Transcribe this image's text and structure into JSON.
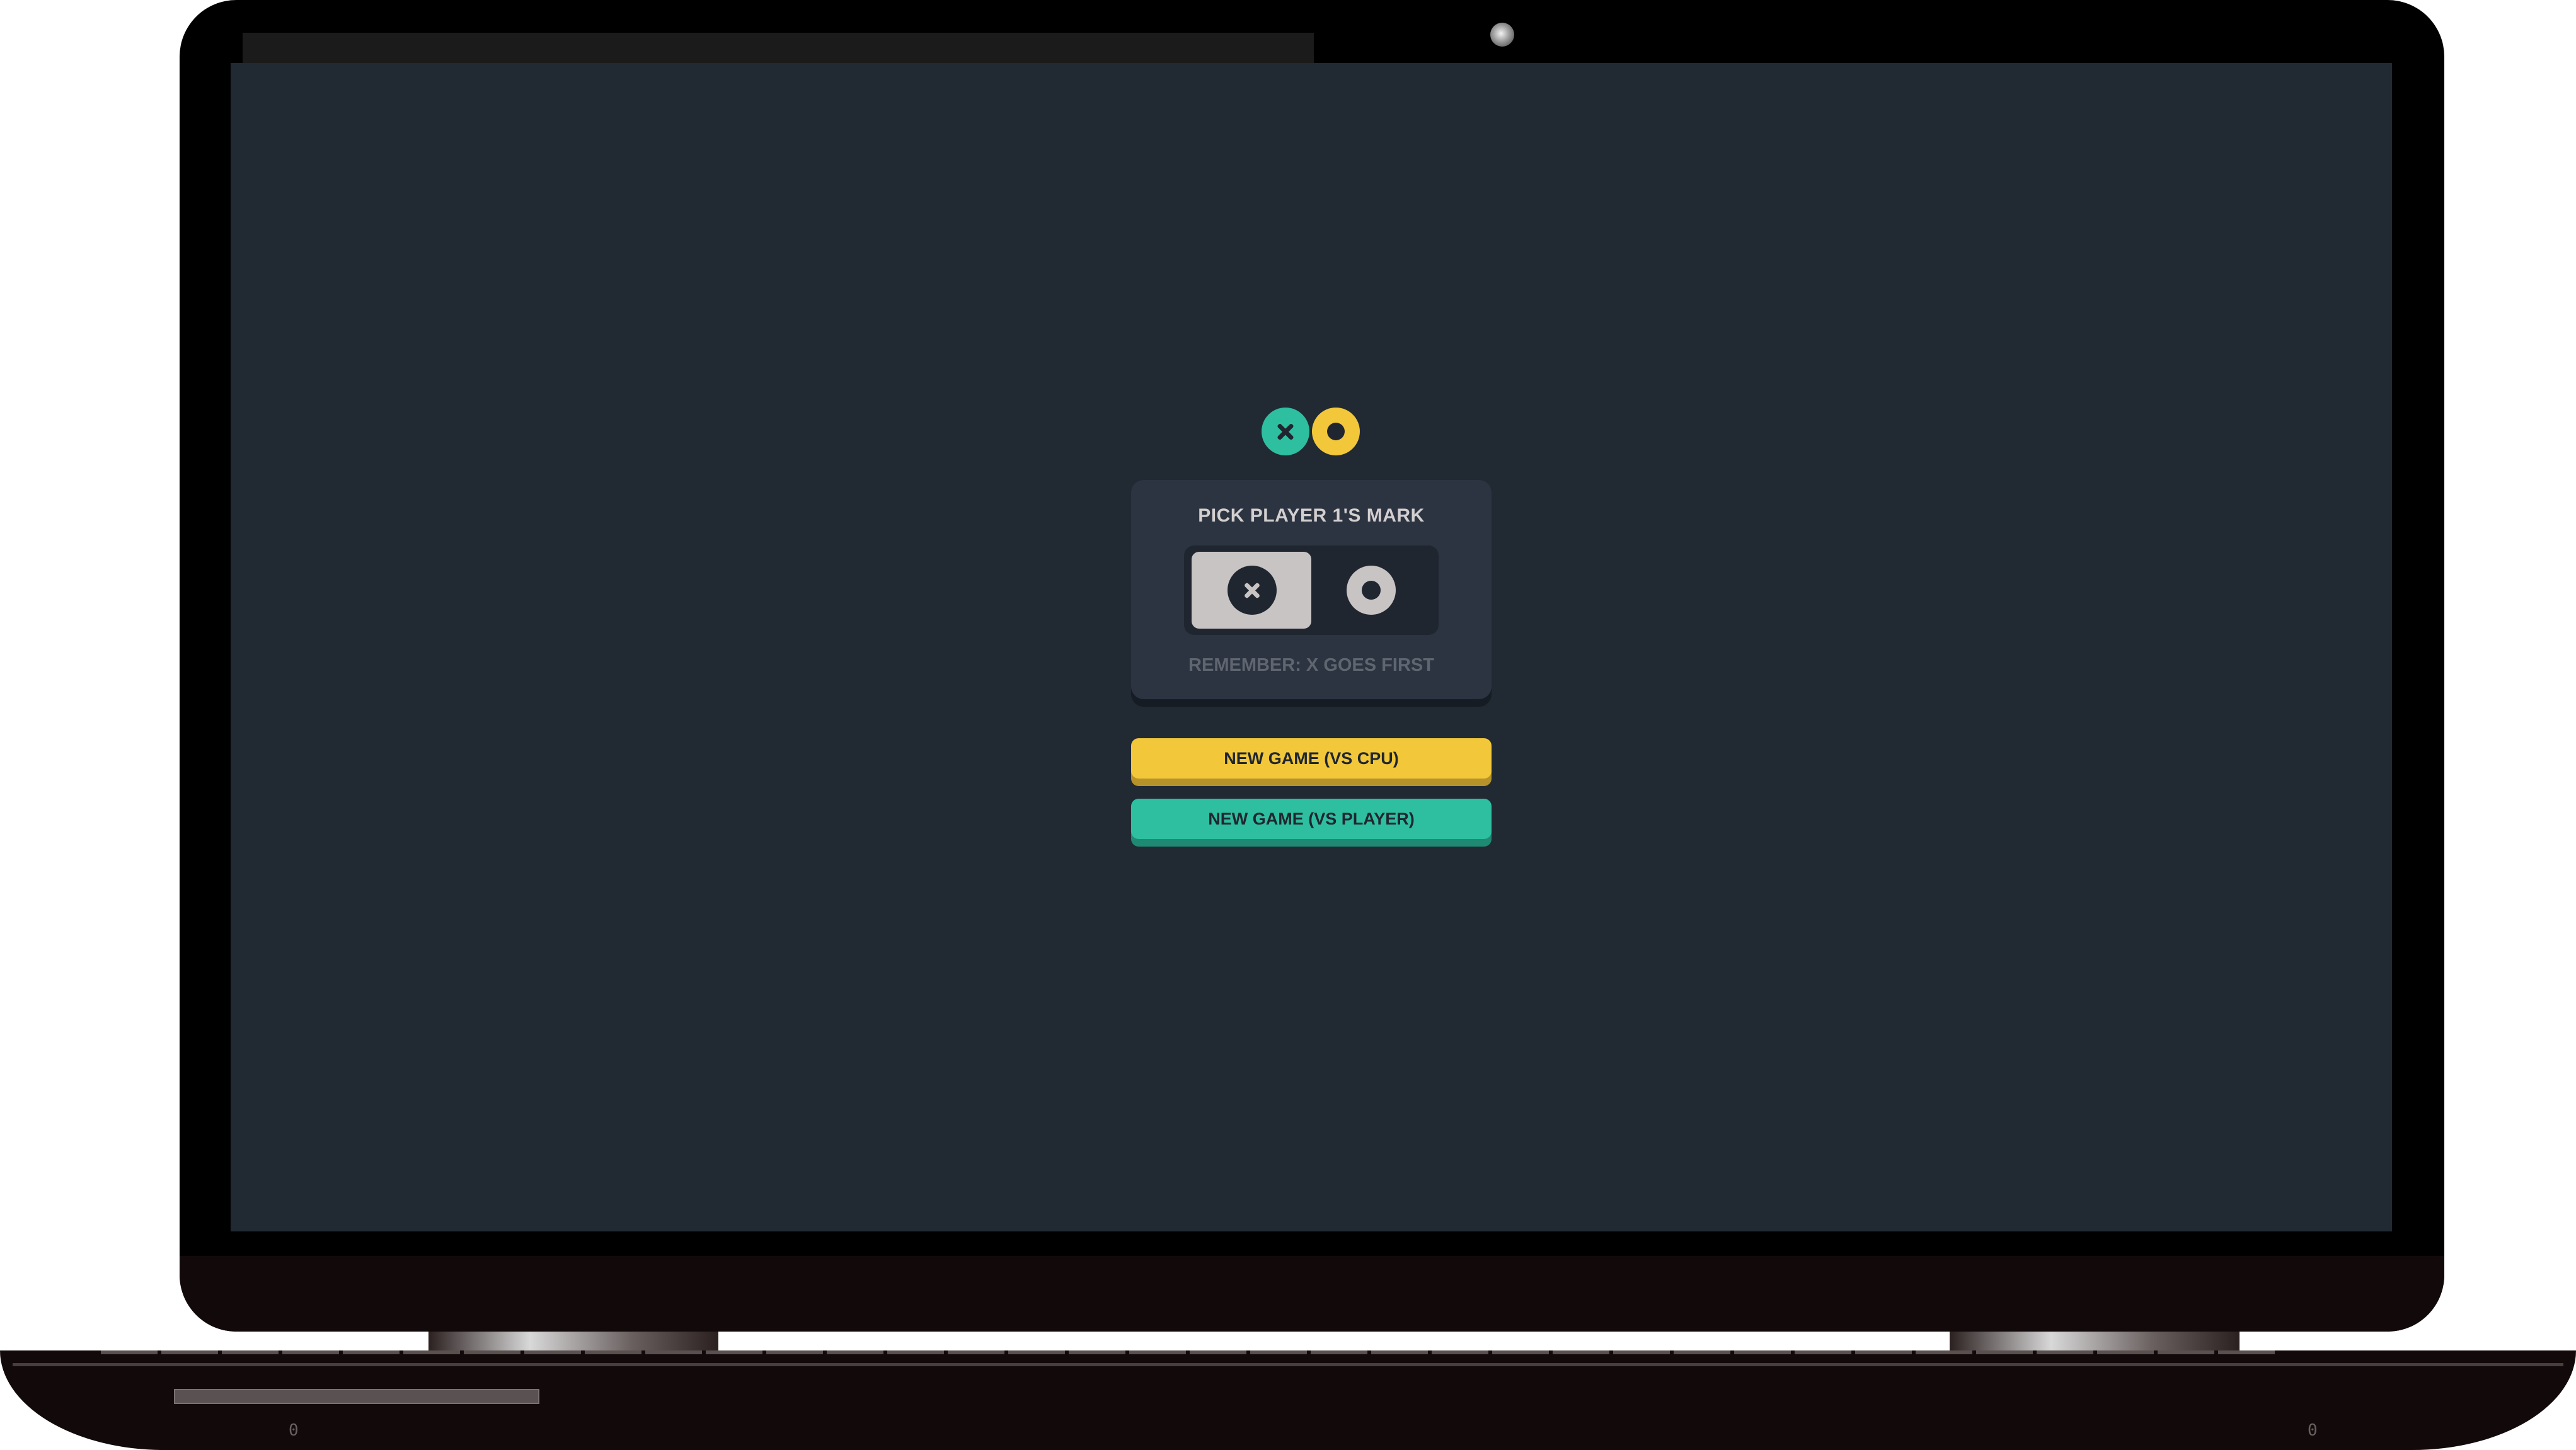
{
  "menu": {
    "logo": {
      "x_icon": "x-mark-icon",
      "o_icon": "o-mark-icon"
    },
    "pick_card": {
      "title": "PICK PLAYER 1'S MARK",
      "options": [
        {
          "mark": "X",
          "icon": "x-mark-icon",
          "selected": true
        },
        {
          "mark": "O",
          "icon": "o-mark-icon",
          "selected": false
        }
      ],
      "hint": "REMEMBER: X GOES FIRST"
    },
    "buttons": {
      "vs_cpu": "NEW GAME (VS CPU)",
      "vs_player": "NEW GAME (VS PLAYER)"
    }
  },
  "device": {
    "footer_left_glyph": "0",
    "footer_right_glyph": "0"
  },
  "colors": {
    "background": "#212933",
    "card": "#2c3442",
    "x_accent": "#2ebfa0",
    "o_accent": "#f2c73a",
    "silver": "#c9c4c4",
    "hint_text": "#5f6670"
  }
}
